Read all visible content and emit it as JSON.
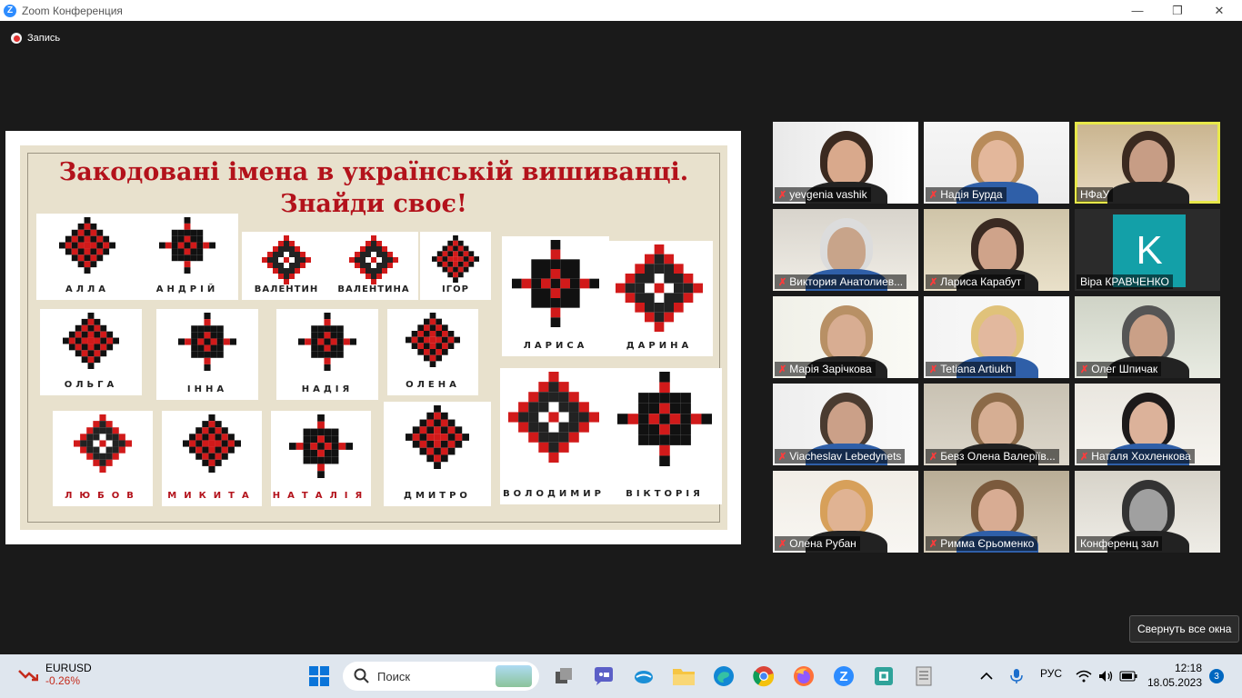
{
  "window": {
    "title": "Zoom Конференция",
    "minimize": "—",
    "maximize": "❐",
    "close": "✕"
  },
  "recording": {
    "label": "Запись"
  },
  "slide": {
    "title_line1": "Закодовані імена в українській вишиванці.",
    "title_line2": "Знайди своє!",
    "names": [
      "АЛЛА",
      "АНДРІЙ",
      "ВАЛЕНТИН",
      "ВАЛЕНТИНА",
      "ІГОР",
      "ЛАРИСА",
      "ДАРИНА",
      "ОЛЬГА",
      "ІННА",
      "НАДІЯ",
      "ОЛЕНА",
      "ЛЮБОВ",
      "МИКИТА",
      "НАТАЛІЯ",
      "ДМИТРО",
      "ВОЛОДИМИР",
      "ВІКТОРІЯ"
    ]
  },
  "participants": [
    {
      "name": "yevgenia vashik",
      "muted": true
    },
    {
      "name": "Надія Бурда",
      "muted": true
    },
    {
      "name": "НФаУ",
      "muted": false,
      "active": true
    },
    {
      "name": "Виктория Анатолиев...",
      "muted": true
    },
    {
      "name": "Лариса Карабут",
      "muted": true
    },
    {
      "name": "Віра КРАВЧЕНКО",
      "muted": false,
      "avatar": "K"
    },
    {
      "name": "Марія Зарічкова",
      "muted": true
    },
    {
      "name": "Tetiana Artiukh",
      "muted": true
    },
    {
      "name": "Олег Шпичак",
      "muted": true
    },
    {
      "name": "Viacheslav Lebedynets",
      "muted": true
    },
    {
      "name": "Бевз Олена Валеріїв...",
      "muted": true
    },
    {
      "name": "Наталя Хохленкова",
      "muted": true
    },
    {
      "name": "Олена Рубан",
      "muted": true
    },
    {
      "name": "Римма Єрьоменко",
      "muted": true
    },
    {
      "name": "Конференц зал",
      "muted": false
    }
  ],
  "tooltip": {
    "text": "Свернуть все окна"
  },
  "taskbar": {
    "widget_title": "EURUSD",
    "widget_value": "-0.26%",
    "search_placeholder": "Поиск",
    "language": "РУС",
    "time": "12:18",
    "date": "18.05.2023",
    "notifications": "3"
  }
}
